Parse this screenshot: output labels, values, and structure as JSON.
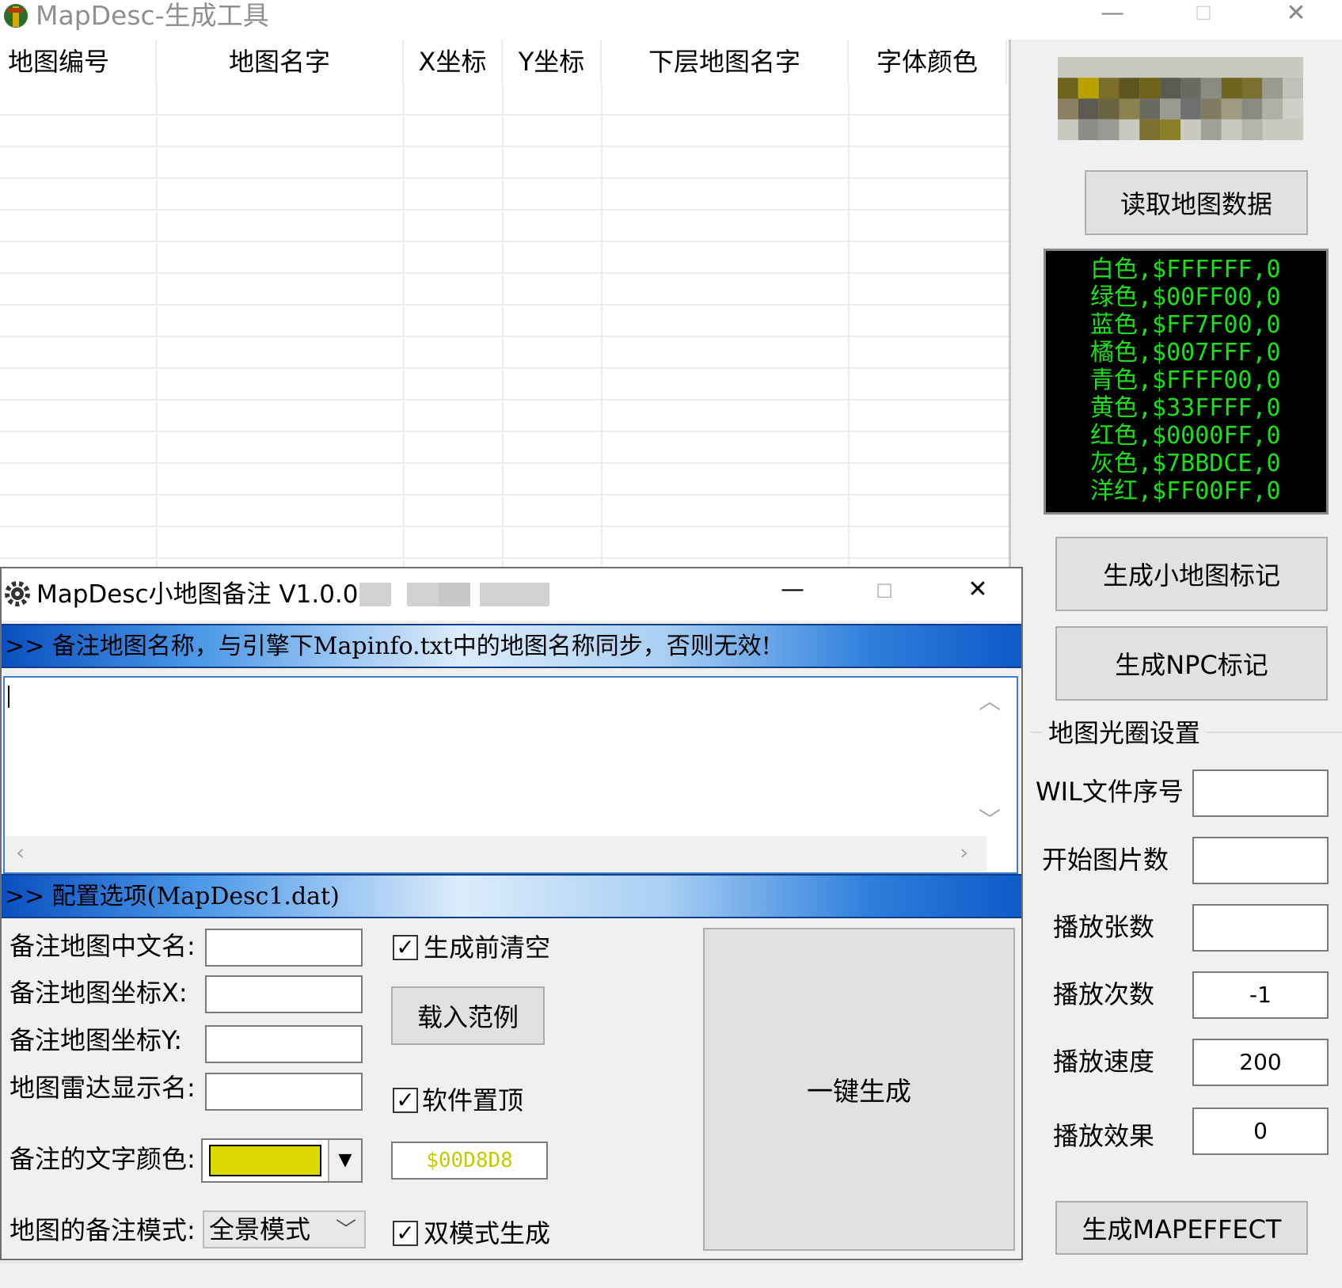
{
  "main_window": {
    "title": "MapDesc-生成工具",
    "controls": {
      "minimize": "—",
      "maximize": "☐",
      "close": "✕"
    }
  },
  "grid": {
    "columns": [
      "地图编号",
      "地图名字",
      "X坐标",
      "Y坐标",
      "下层地图名字",
      "字体颜色"
    ],
    "rows": []
  },
  "right_panel": {
    "read_button": "读取地图数据",
    "color_list": [
      "白色,$FFFFFF,0",
      "绿色,$00FF00,0",
      "蓝色,$FF7F00,0",
      "橘色,$007FFF,0",
      "青色,$FFFF00,0",
      "黄色,$33FFFF,0",
      "红色,$0000FF,0",
      "灰色,$7BBDCE,0",
      "洋红,$FF00FF,0"
    ],
    "gen_minimap_button": "生成小地图标记",
    "gen_npc_button": "生成NPC标记",
    "halo_group_title": "地图光圈设置",
    "halo_fields": [
      {
        "label": "WIL文件序号",
        "value": ""
      },
      {
        "label": "开始图片数",
        "value": ""
      },
      {
        "label": "播放张数",
        "value": ""
      },
      {
        "label": "播放次数",
        "value": "-1"
      },
      {
        "label": "播放速度",
        "value": "200"
      },
      {
        "label": "播放效果",
        "value": "0"
      }
    ],
    "gen_mapeffect_button": "生成MAPEFFECT"
  },
  "dialog": {
    "title": "MapDesc小地图备注 V1.0.0.0",
    "controls": {
      "minimize": "—",
      "maximize": "☐",
      "close": "✕"
    },
    "banner_notes": ">> 备注地图名称，与引擎下Mapinfo.txt中的地图名称同步，否则无效!",
    "memo_value": "",
    "banner_config": ">> 配置选项(MapDesc1.dat)",
    "config": {
      "label_cn_name": "备注地图中文名:",
      "label_x": "备注地图坐标X:",
      "label_y": "备注地图坐标Y:",
      "label_radar": "地图雷达显示名:",
      "label_color": "备注的文字颜色:",
      "label_mode": "地图的备注模式:",
      "color_value": "$00D8D8",
      "color_swatch": "#dcd800",
      "mode_value": "全景模式",
      "cb_clear_before": "生成前清空",
      "load_example_button": "载入范例",
      "cb_always_on_top": "软件置顶",
      "cb_dual_mode": "双模式生成",
      "generate_button": "一键生成"
    }
  },
  "colors": {
    "list_text": "#19e019",
    "list_bg": "#000000",
    "color_code_text": "#c8c800"
  }
}
